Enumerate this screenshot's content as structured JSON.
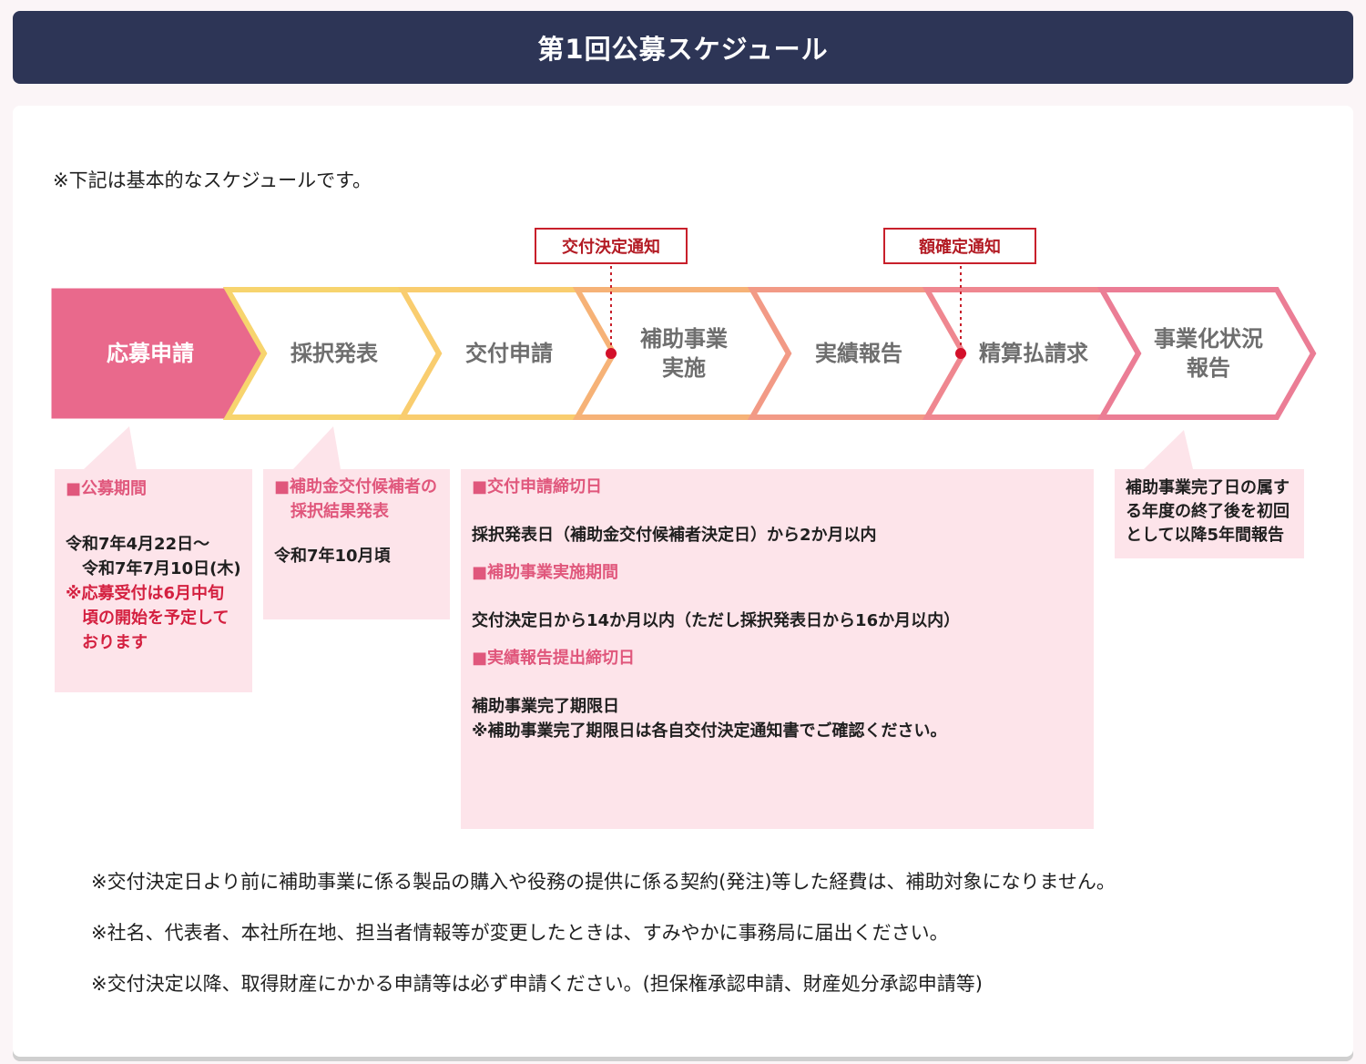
{
  "page_title": "第1回公募スケジュール",
  "top_note": "※下記は基本的なスケジュールです。",
  "callouts": {
    "koufu_kettei": "交付決定通知",
    "gaku_kakutei": "額確定通知"
  },
  "steps": [
    {
      "line1": "応募申請",
      "line2": ""
    },
    {
      "line1": "採択発表",
      "line2": ""
    },
    {
      "line1": "交付申請",
      "line2": ""
    },
    {
      "line1": "補助事業",
      "line2": "実施"
    },
    {
      "line1": "実績報告",
      "line2": ""
    },
    {
      "line1": "精算払請求",
      "line2": ""
    },
    {
      "line1": "事業化状況",
      "line2": "報告"
    }
  ],
  "colors": {
    "active_fill": "#e9698c",
    "gradient": [
      "#f7d46e",
      "#f9cd6f",
      "#f6b277",
      "#f29a86",
      "#ef8790",
      "#eb7d95"
    ],
    "callout_border": "#c8202b",
    "info_box": "#fde4ea",
    "header_bg": "#2d3556"
  },
  "box_boshu": {
    "heading": "■公募期間",
    "date1": "令和7年4月22日～",
    "date2": "令和7年7月10日(木)",
    "note1": "※応募受付は6月中旬",
    "note2": "頃の開始を予定して",
    "note3": "おります"
  },
  "box_saitaku": {
    "heading1": "■補助金交付候補者の",
    "heading2": "採択結果発表",
    "text": "令和7年10月頃"
  },
  "box_koufu": {
    "h1": "■交付申請締切日",
    "t1": "採択発表日（補助金交付候補者決定日）から2か月以内",
    "h2": "■補助事業実施期間",
    "t2": "交付決定日から14か月以内（ただし採択発表日から16か月以内）",
    "h3": "■実績報告提出締切日",
    "t3a": "補助事業完了期限日",
    "t3b": "※補助事業完了期限日は各自交付決定通知書でご確認ください。"
  },
  "box_jigyouka": {
    "l1": "補助事業完了日の属す",
    "l2": "る年度の終了後を初回",
    "l3": "として以降5年間報告"
  },
  "footnotes": [
    "※交付決定日より前に補助事業に係る製品の購入や役務の提供に係る契約(発注)等した経費は、補助対象になりません。",
    "※社名、代表者、本社所在地、担当者情報等が変更したときは、すみやかに事務局に届出ください。",
    "※交付決定以降、取得財産にかかる申請等は必ず申請ください。(担保権承認申請、財産処分承認申請等)"
  ]
}
